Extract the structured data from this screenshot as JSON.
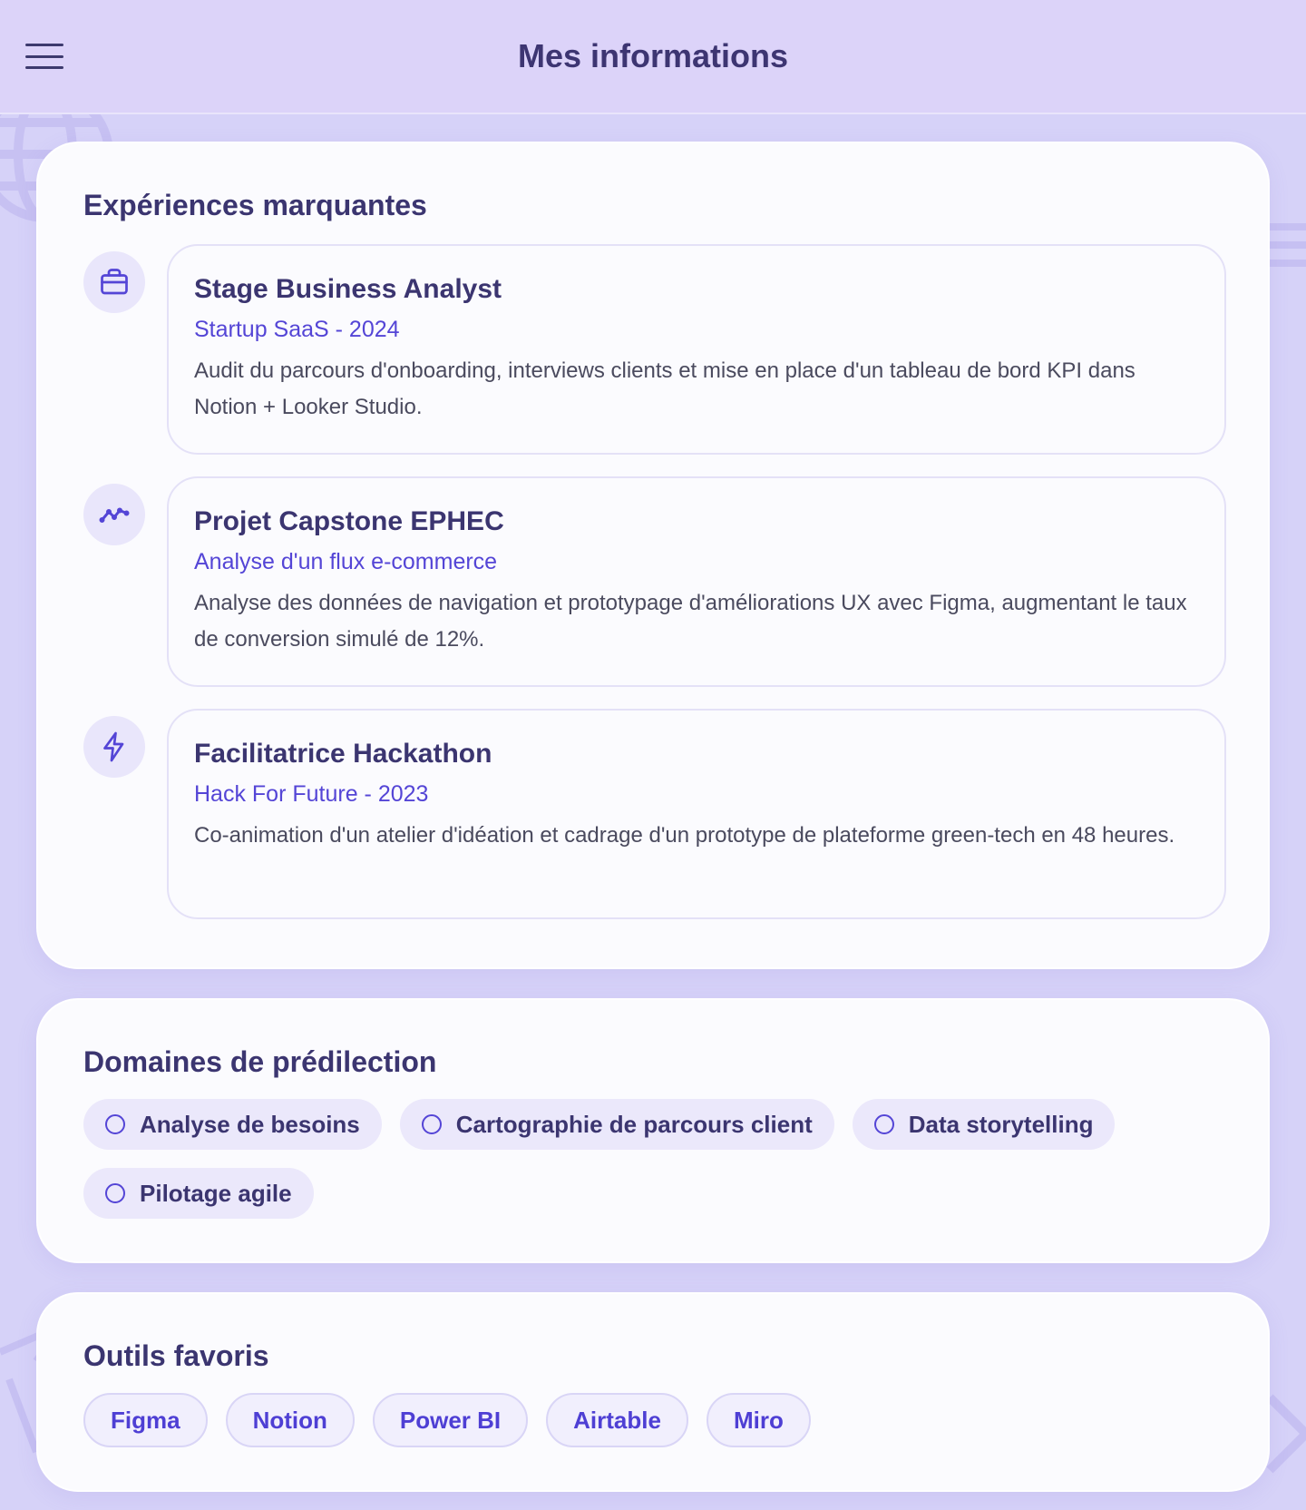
{
  "header": {
    "title": "Mes informations",
    "menu_icon": "hamburger-menu-icon"
  },
  "experiences": {
    "title": "Expériences marquantes",
    "items": [
      {
        "icon": "briefcase-icon",
        "title": "Stage Business Analyst",
        "subtitle": "Startup SaaS - 2024",
        "description": "Audit du parcours d'onboarding, interviews clients et mise en place d'un tableau de bord KPI dans Notion + Looker Studio."
      },
      {
        "icon": "trend-line-icon",
        "title": "Projet Capstone EPHEC",
        "subtitle": "Analyse d'un flux e-commerce",
        "description": "Analyse des données de navigation et prototypage d'améliorations UX avec Figma, augmentant le taux de conversion simulé de 12%."
      },
      {
        "icon": "lightning-icon",
        "title": "Facilitatrice Hackathon",
        "subtitle": "Hack For Future - 2023",
        "description": "Co-animation d'un atelier d'idéation et cadrage d'un prototype de plateforme green-tech en 48 heures."
      }
    ]
  },
  "domains": {
    "title": "Domaines de prédilection",
    "items": [
      "Analyse de besoins",
      "Cartographie de parcours client",
      "Data storytelling",
      "Pilotage agile"
    ]
  },
  "tools": {
    "title": "Outils favoris",
    "items": [
      "Figma",
      "Notion",
      "Power BI",
      "Airtable",
      "Miro"
    ]
  },
  "colors": {
    "background": "#d6d2f8",
    "header": "#dcd3f9",
    "accent": "#5445d6",
    "heading": "#3b3570"
  }
}
